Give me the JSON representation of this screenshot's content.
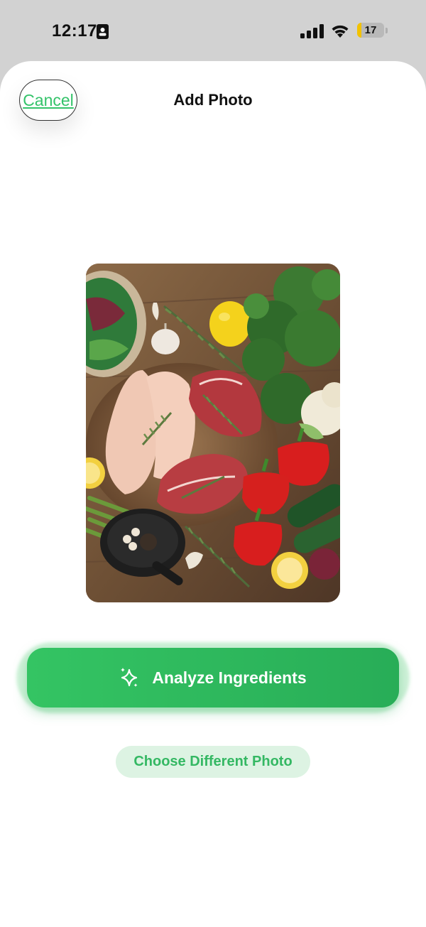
{
  "status_bar": {
    "time": "12:17",
    "battery_level": "17",
    "battery_fraction": 0.17
  },
  "header": {
    "cancel_label": "Cancel",
    "title": "Add Photo"
  },
  "photo": {
    "icon": "food-photo"
  },
  "actions": {
    "analyze_label": "Analyze Ingredients",
    "analyze_icon": "sparkles-icon",
    "choose_label": "Choose Different Photo"
  },
  "colors": {
    "accent": "#34c36a",
    "accent_dark": "#28ad57",
    "accent_light": "#ddf3e3"
  }
}
